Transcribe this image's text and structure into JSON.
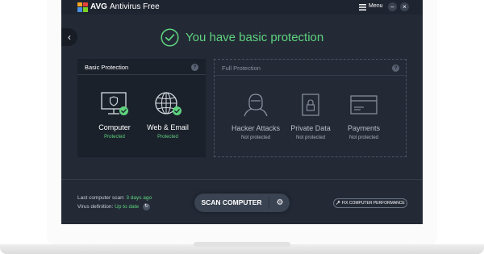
{
  "titlebar": {
    "brand": "AVG",
    "product": "Antivirus Free",
    "menu_label": "Menu",
    "minimize_symbol": "–",
    "close_symbol": "×"
  },
  "back_symbol": "‹",
  "status": {
    "text": "You have basic protection",
    "icon": "check-circle-icon",
    "color": "#5fd37e"
  },
  "basic_panel": {
    "title": "Basic Protection",
    "help": "?",
    "items": [
      {
        "name": "Computer",
        "status": "Protected",
        "icon": "monitor-shield-icon"
      },
      {
        "name": "Web & Email",
        "status": "Protected",
        "icon": "globe-icon"
      }
    ]
  },
  "full_panel": {
    "title": "Full Protection",
    "help": "?",
    "items": [
      {
        "name": "Hacker Attacks",
        "status": "Not protected",
        "icon": "hacker-icon"
      },
      {
        "name": "Private Data",
        "status": "Not protected",
        "icon": "lock-icon"
      },
      {
        "name": "Payments",
        "status": "Not protected",
        "icon": "credit-card-icon"
      }
    ]
  },
  "footer": {
    "last_scan_label": "Last computer scan:",
    "last_scan_value": "3 days ago",
    "definition_label": "Virus definition:",
    "definition_value": "Up to date",
    "refresh_symbol": "↻",
    "scan_button": "SCAN COMPUTER",
    "settings_symbol": "⚙",
    "fix_button": "FIX COMPUTER PERFORMANCE",
    "fix_icon": "wrench-icon"
  },
  "colors": {
    "background": "#232a36",
    "accent_green": "#5fd37e",
    "panel": "#1b212b"
  }
}
